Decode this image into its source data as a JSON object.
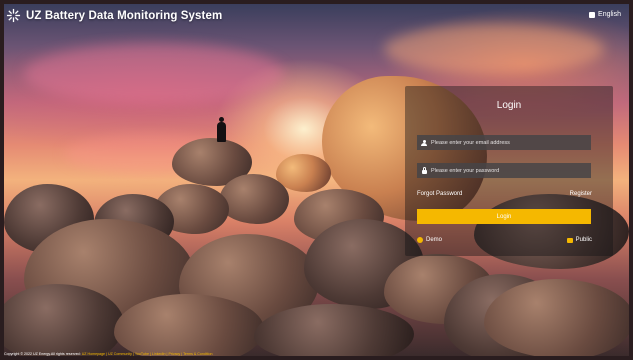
{
  "header": {
    "logo_icon": "uz-energy-logo-icon",
    "title": "UZ Battery Data Monitoring System",
    "language_icon": "globe-icon",
    "language": "English"
  },
  "login": {
    "title": "Login",
    "email_icon": "user-icon",
    "email_placeholder": "Please enter your email address",
    "email_value": "",
    "password_icon": "lock-icon",
    "password_placeholder": "Please enter your password",
    "password_value": "",
    "forgot_password": "Forgot Password",
    "register": "Register",
    "login_button": "Login",
    "demo_icon": "demo-icon",
    "demo": "Demo",
    "public_icon": "public-icon",
    "public": "Public"
  },
  "footer": {
    "copyright": "Copyright © 2022 UZ Energy.All rights reserved",
    "links": [
      "UZ Homepage",
      "UZ Community",
      "YouTube",
      "LinkedIn",
      "Privacy",
      "Terms & Condition"
    ]
  },
  "colors": {
    "accent": "#f5b800",
    "panel": "rgba(20,20,22,0.42)",
    "input": "#464446"
  }
}
